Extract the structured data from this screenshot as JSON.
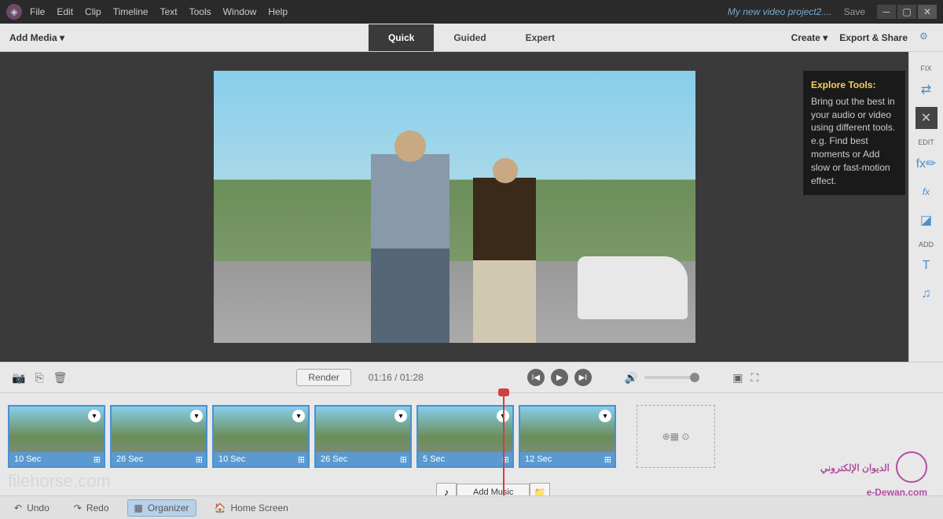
{
  "titlebar": {
    "menus": [
      "File",
      "Edit",
      "Clip",
      "Timeline",
      "Text",
      "Tools",
      "Window",
      "Help"
    ],
    "project_name": "My new video project2....",
    "save": "Save"
  },
  "toolbar": {
    "add_media": "Add Media ▾",
    "modes": [
      "Quick",
      "Guided",
      "Expert"
    ],
    "create": "Create ▾",
    "export": "Export & Share"
  },
  "tooltip": {
    "title": "Explore Tools:",
    "body": "Bring out the best in your audio or video using different tools. e.g. Find best moments or Add slow or fast-motion effect."
  },
  "right_panel": {
    "sections": [
      "FIX",
      "EDIT",
      "ADD"
    ]
  },
  "controls": {
    "render": "Render",
    "time": "01:16 / 01:28"
  },
  "timeline": {
    "clips": [
      {
        "duration": "10 Sec"
      },
      {
        "duration": "26 Sec"
      },
      {
        "duration": "10 Sec"
      },
      {
        "duration": "26 Sec"
      },
      {
        "duration": "5 Sec"
      },
      {
        "duration": "12 Sec"
      }
    ],
    "add_music": "Add Music"
  },
  "bottom": {
    "undo": "Undo",
    "redo": "Redo",
    "organizer": "Organizer",
    "home": "Home Screen"
  },
  "watermarks": {
    "filehorse": "filehorse.com",
    "edewan_ar": "الديوان الإلكتروني",
    "edewan_en": "e-Dewan.com"
  }
}
